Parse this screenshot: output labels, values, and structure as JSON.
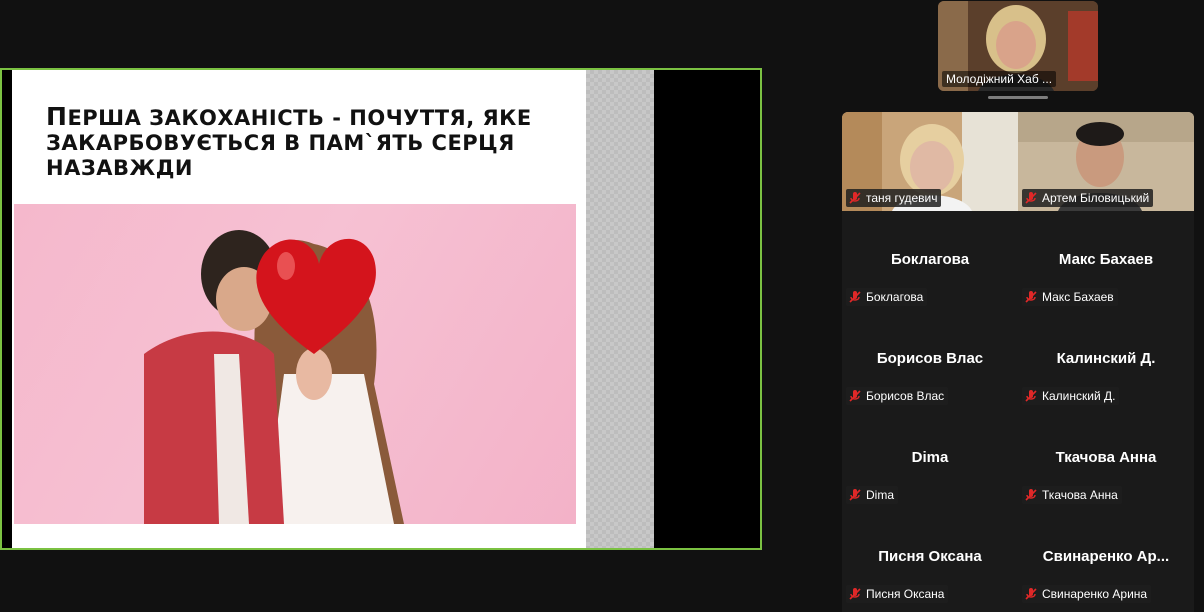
{
  "slide": {
    "title_line1_cap": "П",
    "title_line1_rest": "ерша закоханість - почуття, яке",
    "title_line2": "закарбовується в пам`ять серця",
    "title_line3": "назавжди"
  },
  "speaker": {
    "name": "Молодіжний Хаб ..."
  },
  "participants": [
    {
      "name": "таня гудевич",
      "video": true
    },
    {
      "name": "Артем Біловицький",
      "video": true
    },
    {
      "name": "Боклагова",
      "display": "Боклагова"
    },
    {
      "name": "Макс Бахаев",
      "display": "Макс Бахаев"
    },
    {
      "name": "Борисов Влас",
      "display": "Борисов Влас"
    },
    {
      "name": "Калинский Д.",
      "display": "Калинский Д."
    },
    {
      "name": "Dima",
      "display": "Dima"
    },
    {
      "name": "Ткачова Анна",
      "display": "Ткачова Анна"
    },
    {
      "name": "Писня Оксана",
      "display": "Писня Оксана"
    },
    {
      "name": "Свинаренко Арина",
      "display": "Свинаренко  Ар..."
    }
  ],
  "colors": {
    "share_border": "#7bc142",
    "mute_icon": "#e02828",
    "background": "#111111"
  }
}
